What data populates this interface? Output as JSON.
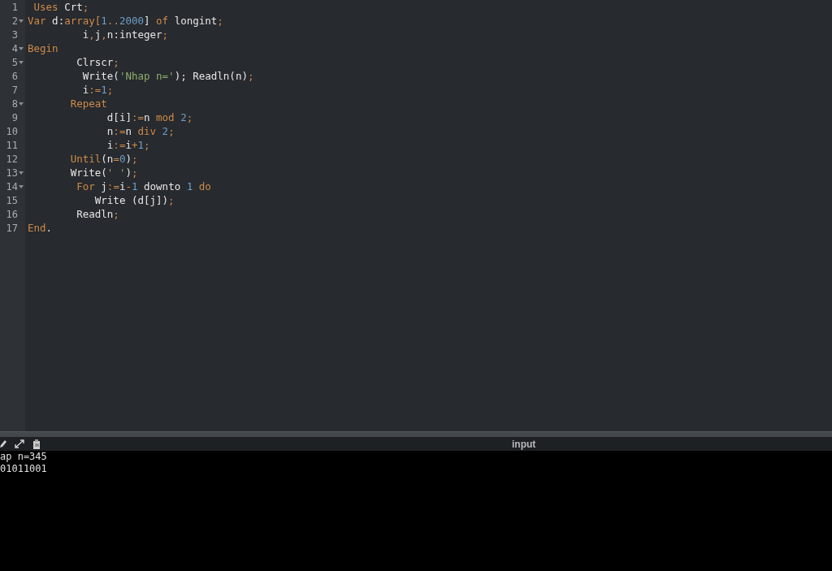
{
  "editor": {
    "lines": [
      {
        "number": "1",
        "fold": false,
        "tokens": [
          {
            "text": " Uses",
            "kind": "kw"
          },
          {
            "text": " Crt",
            "kind": "id"
          },
          {
            "text": ";",
            "kind": "op"
          }
        ]
      },
      {
        "number": "2",
        "fold": true,
        "tokens": [
          {
            "text": "Var",
            "kind": "kw"
          },
          {
            "text": " d:",
            "kind": "id"
          },
          {
            "text": "array",
            "kind": "kw"
          },
          {
            "text": "[",
            "kind": "op"
          },
          {
            "text": "1",
            "kind": "num"
          },
          {
            "text": "..",
            "kind": "op"
          },
          {
            "text": "2000",
            "kind": "num"
          },
          {
            "text": "]",
            "kind": "id"
          },
          {
            "text": " of",
            "kind": "kw"
          },
          {
            "text": " longint",
            "kind": "id"
          },
          {
            "text": ";",
            "kind": "op"
          }
        ]
      },
      {
        "number": "3",
        "fold": false,
        "tokens": [
          {
            "text": "         i",
            "kind": "id"
          },
          {
            "text": ",",
            "kind": "op"
          },
          {
            "text": "j",
            "kind": "id"
          },
          {
            "text": ",",
            "kind": "op"
          },
          {
            "text": "n:integer",
            "kind": "id"
          },
          {
            "text": ";",
            "kind": "op"
          }
        ]
      },
      {
        "number": "4",
        "fold": true,
        "tokens": [
          {
            "text": "Begin",
            "kind": "kw"
          }
        ]
      },
      {
        "number": "5",
        "fold": true,
        "tokens": [
          {
            "text": "        Clrscr",
            "kind": "id"
          },
          {
            "text": ";",
            "kind": "op"
          }
        ]
      },
      {
        "number": "6",
        "fold": false,
        "tokens": [
          {
            "text": "         Write(",
            "kind": "id"
          },
          {
            "text": "'Nhap n='",
            "kind": "str"
          },
          {
            "text": ");",
            "kind": "id"
          },
          {
            "text": " Readln(n)",
            "kind": "id"
          },
          {
            "text": ";",
            "kind": "op"
          }
        ]
      },
      {
        "number": "7",
        "fold": false,
        "tokens": [
          {
            "text": "         i",
            "kind": "id"
          },
          {
            "text": ":=",
            "kind": "op"
          },
          {
            "text": "1",
            "kind": "num"
          },
          {
            "text": ";",
            "kind": "op"
          }
        ]
      },
      {
        "number": "8",
        "fold": true,
        "tokens": [
          {
            "text": "       Repeat",
            "kind": "kw"
          }
        ]
      },
      {
        "number": "9",
        "fold": false,
        "tokens": [
          {
            "text": "             d[i]",
            "kind": "id"
          },
          {
            "text": ":=",
            "kind": "op"
          },
          {
            "text": "n ",
            "kind": "id"
          },
          {
            "text": "mod",
            "kind": "kw"
          },
          {
            "text": " 2",
            "kind": "num"
          },
          {
            "text": ";",
            "kind": "op"
          }
        ]
      },
      {
        "number": "10",
        "fold": false,
        "tokens": [
          {
            "text": "             n",
            "kind": "id"
          },
          {
            "text": ":=",
            "kind": "op"
          },
          {
            "text": "n ",
            "kind": "id"
          },
          {
            "text": "div",
            "kind": "kw"
          },
          {
            "text": " 2",
            "kind": "num"
          },
          {
            "text": ";",
            "kind": "op"
          }
        ]
      },
      {
        "number": "11",
        "fold": false,
        "tokens": [
          {
            "text": "             i",
            "kind": "id"
          },
          {
            "text": ":=",
            "kind": "op"
          },
          {
            "text": "i",
            "kind": "id"
          },
          {
            "text": "+",
            "kind": "op"
          },
          {
            "text": "1",
            "kind": "num"
          },
          {
            "text": ";",
            "kind": "op"
          }
        ]
      },
      {
        "number": "12",
        "fold": false,
        "tokens": [
          {
            "text": "       Until",
            "kind": "kw"
          },
          {
            "text": "(n",
            "kind": "id"
          },
          {
            "text": "=",
            "kind": "op"
          },
          {
            "text": "0",
            "kind": "num"
          },
          {
            "text": ")",
            "kind": "id"
          },
          {
            "text": ";",
            "kind": "op"
          }
        ]
      },
      {
        "number": "13",
        "fold": true,
        "tokens": [
          {
            "text": "       Write(",
            "kind": "id"
          },
          {
            "text": "' '",
            "kind": "str"
          },
          {
            "text": ")",
            "kind": "id"
          },
          {
            "text": ";",
            "kind": "op"
          }
        ]
      },
      {
        "number": "14",
        "fold": true,
        "tokens": [
          {
            "text": "        For",
            "kind": "kw"
          },
          {
            "text": " j",
            "kind": "id"
          },
          {
            "text": ":=",
            "kind": "op"
          },
          {
            "text": "i",
            "kind": "id"
          },
          {
            "text": "-",
            "kind": "op"
          },
          {
            "text": "1",
            "kind": "num"
          },
          {
            "text": " downto ",
            "kind": "id"
          },
          {
            "text": "1",
            "kind": "num"
          },
          {
            "text": " do",
            "kind": "kw"
          }
        ]
      },
      {
        "number": "15",
        "fold": false,
        "tokens": [
          {
            "text": "           Write (d[j])",
            "kind": "id"
          },
          {
            "text": ";",
            "kind": "op"
          }
        ]
      },
      {
        "number": "16",
        "fold": false,
        "tokens": [
          {
            "text": "        Readln",
            "kind": "id"
          },
          {
            "text": ";",
            "kind": "op"
          }
        ]
      },
      {
        "number": "17",
        "fold": false,
        "tokens": [
          {
            "text": "End",
            "kind": "kw"
          },
          {
            "text": ".",
            "kind": "id"
          }
        ]
      }
    ]
  },
  "console": {
    "label": "input",
    "output": [
      "ap n=345",
      "01011001"
    ]
  }
}
